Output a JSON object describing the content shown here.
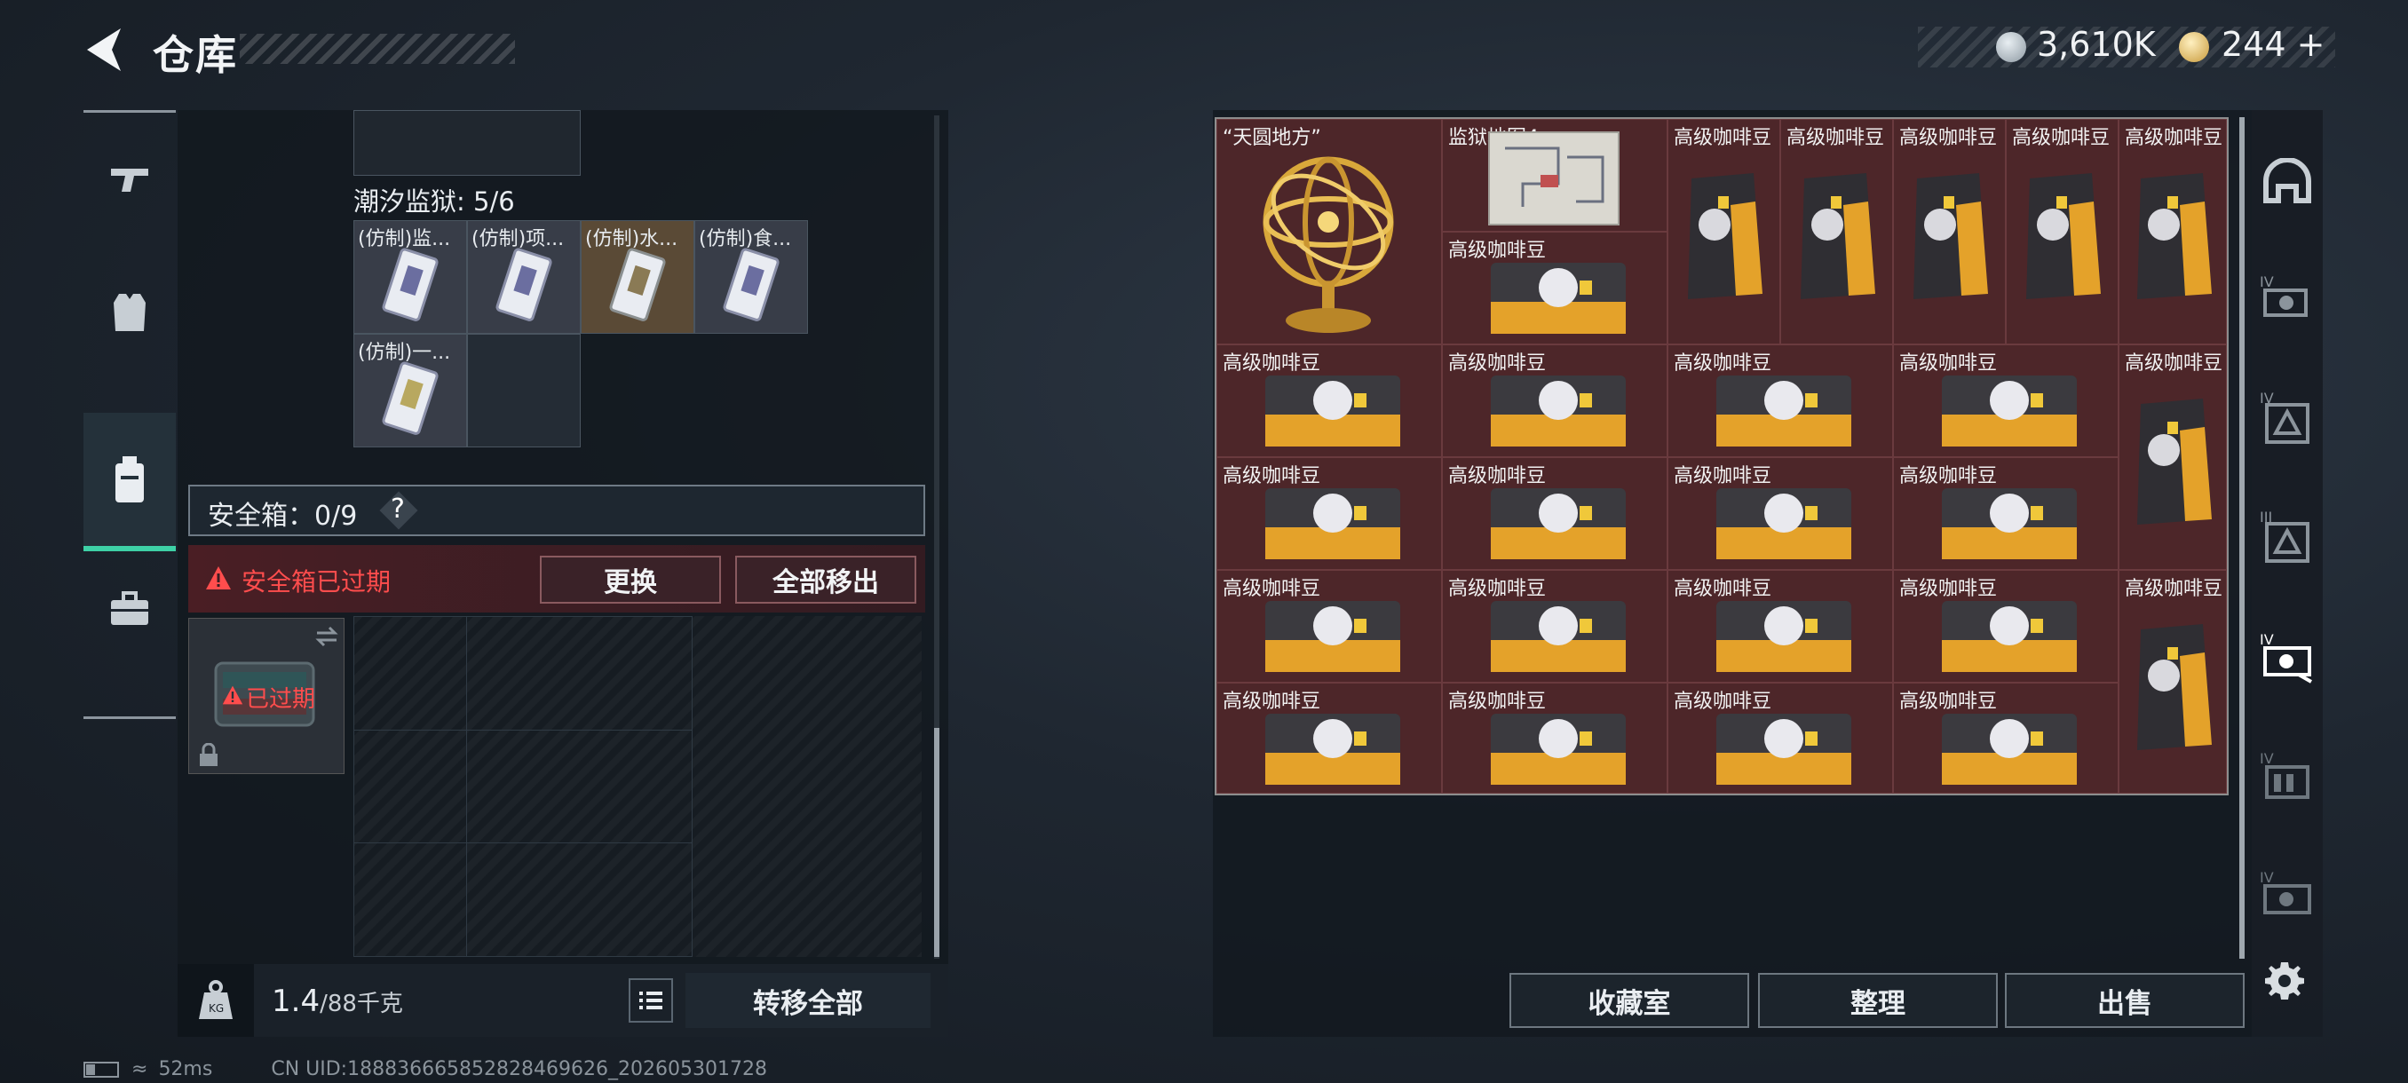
{
  "header": {
    "title": "仓库"
  },
  "currency": [
    {
      "icon": "silver-coin-icon",
      "value": "3,610K"
    },
    {
      "icon": "gold-coin-icon",
      "value": "244"
    }
  ],
  "left_nav": [
    "gun-icon",
    "vest-icon",
    "backpack-icon",
    "briefcase-icon"
  ],
  "prison": {
    "label": "潮汐监狱: 5/6",
    "items": [
      "(仿制)监...",
      "(仿制)项...",
      "(仿制)水...",
      "(仿制)食...",
      "(仿制)一..."
    ]
  },
  "safebox": {
    "label": "安全箱：0/9",
    "help": "?",
    "expired_msg": "安全箱已过期",
    "replace_label": "更换",
    "move_all_label": "全部移出",
    "item_status": "已过期"
  },
  "weight": {
    "value": "1.4",
    "max": "/88千克"
  },
  "transfer_all_label": "转移全部",
  "status": {
    "ping": "52ms",
    "uid": "CN UID:1888366658528284696​26_202605301728"
  },
  "stash_items": {
    "armillary": "“天圆地方”",
    "map": "监狱地图4",
    "coffee": "高级咖啡豆"
  },
  "right_buttons": {
    "collection": "收藏室",
    "organize": "整理",
    "sell": "出售"
  },
  "right_nav": [
    "helmet-icon",
    "camera-icon",
    "tool-icon",
    "tool2-icon",
    "console-icon",
    "storage-icon",
    "console2-icon"
  ]
}
